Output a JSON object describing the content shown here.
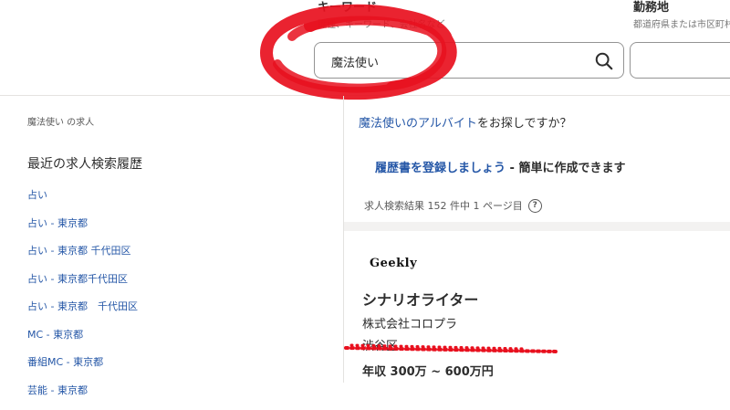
{
  "header": {
    "keyword_label": "キーワード",
    "keyword_hint": "職種、キーワード、会社名など",
    "keyword_value": "魔法使い",
    "location_label": "勤務地",
    "location_hint": "都道府県または市区町村"
  },
  "left": {
    "breadcrumb": "魔法使い の求人",
    "recent_title": "最近の求人検索履歴",
    "recent_items": [
      "占い",
      "占い - 東京都",
      "占い - 東京都 千代田区",
      "占い - 東京都千代田区",
      "占い - 東京都　千代田区",
      "MC - 東京都",
      "番組MC - 東京都",
      "芸能 - 東京都"
    ]
  },
  "right": {
    "promo_link": "魔法使いのアルバイト",
    "promo_text": "をお探しですか？",
    "resume_link": "履歴書を登録しましょう",
    "resume_text": " - 簡単に作成できます",
    "result_count": "求人検索結果 152 件中 1 ページ目",
    "help": "?"
  },
  "job": {
    "logo": "Geekly",
    "title": "シナリオライター",
    "company": "株式会社コロプラ",
    "location": "渋谷区",
    "salary": "年収 300万 ~ 600万円"
  },
  "colors": {
    "link": "#2557a7",
    "scribble": "#e8101e"
  }
}
